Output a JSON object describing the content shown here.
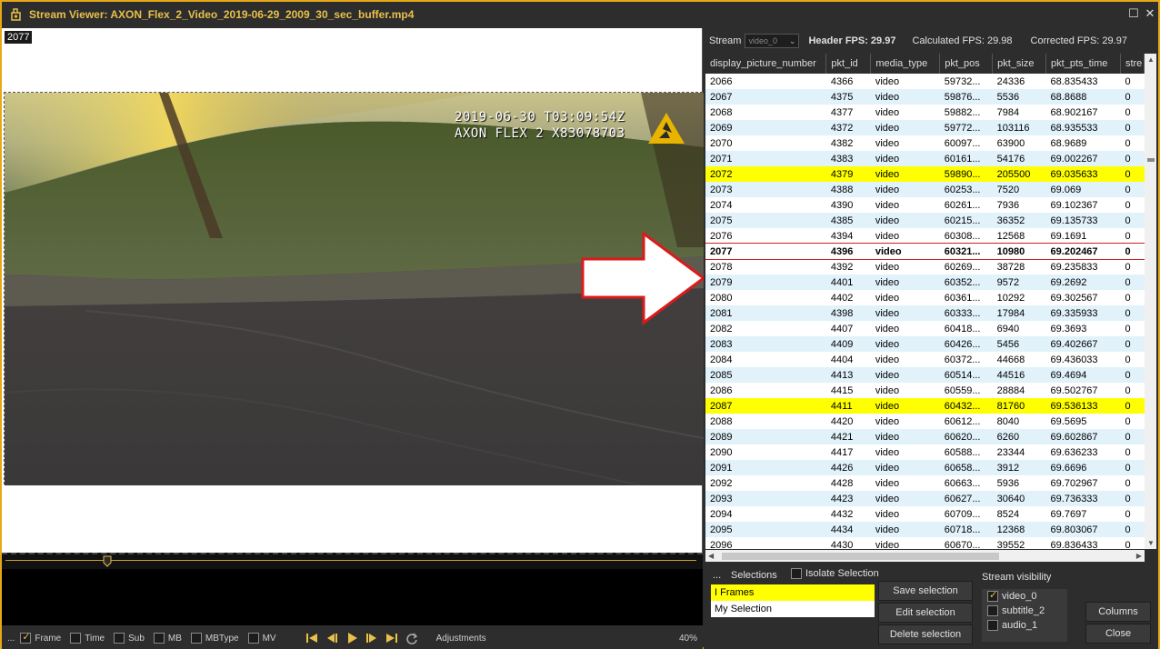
{
  "window": {
    "title": "Stream Viewer: AXON_Flex_2_Video_2019-06-29_2009_30_sec_buffer.mp4"
  },
  "video": {
    "frame_label": "2077",
    "osd_line1": "2019-06-30 T03:09:54Z",
    "osd_line2": "AXON FLEX 2 X83078703"
  },
  "toolbar": {
    "more": "...",
    "frame": "Frame",
    "time": "Time",
    "sub": "Sub",
    "mb": "MB",
    "mbtype": "MBType",
    "mv": "MV",
    "adjustments": "Adjustments",
    "zoom": "40%"
  },
  "stream_header": {
    "stream_label": "Stream",
    "stream_value": "video_0",
    "header_fps": "Header FPS: 29.97",
    "calc_fps": "Calculated FPS: 29.98",
    "corrected_fps": "Corrected FPS: 29.97"
  },
  "table": {
    "columns": [
      "display_picture_number",
      "pkt_id",
      "media_type",
      "pkt_pos",
      "pkt_size",
      "pkt_pts_time",
      "stre"
    ],
    "rows": [
      [
        "2066",
        "4366",
        "video",
        "59732...",
        "24336",
        "68.835433",
        "0"
      ],
      [
        "2067",
        "4375",
        "video",
        "59876...",
        "5536",
        "68.8688",
        "0"
      ],
      [
        "2068",
        "4377",
        "video",
        "59882...",
        "7984",
        "68.902167",
        "0"
      ],
      [
        "2069",
        "4372",
        "video",
        "59772...",
        "103116",
        "68.935533",
        "0"
      ],
      [
        "2070",
        "4382",
        "video",
        "60097...",
        "63900",
        "68.9689",
        "0"
      ],
      [
        "2071",
        "4383",
        "video",
        "60161...",
        "54176",
        "69.002267",
        "0"
      ],
      [
        "2072",
        "4379",
        "video",
        "59890...",
        "205500",
        "69.035633",
        "0"
      ],
      [
        "2073",
        "4388",
        "video",
        "60253...",
        "7520",
        "69.069",
        "0"
      ],
      [
        "2074",
        "4390",
        "video",
        "60261...",
        "7936",
        "69.102367",
        "0"
      ],
      [
        "2075",
        "4385",
        "video",
        "60215...",
        "36352",
        "69.135733",
        "0"
      ],
      [
        "2076",
        "4394",
        "video",
        "60308...",
        "12568",
        "69.1691",
        "0"
      ],
      [
        "2077",
        "4396",
        "video",
        "60321...",
        "10980",
        "69.202467",
        "0"
      ],
      [
        "2078",
        "4392",
        "video",
        "60269...",
        "38728",
        "69.235833",
        "0"
      ],
      [
        "2079",
        "4401",
        "video",
        "60352...",
        "9572",
        "69.2692",
        "0"
      ],
      [
        "2080",
        "4402",
        "video",
        "60361...",
        "10292",
        "69.302567",
        "0"
      ],
      [
        "2081",
        "4398",
        "video",
        "60333...",
        "17984",
        "69.335933",
        "0"
      ],
      [
        "2082",
        "4407",
        "video",
        "60418...",
        "6940",
        "69.3693",
        "0"
      ],
      [
        "2083",
        "4409",
        "video",
        "60426...",
        "5456",
        "69.402667",
        "0"
      ],
      [
        "2084",
        "4404",
        "video",
        "60372...",
        "44668",
        "69.436033",
        "0"
      ],
      [
        "2085",
        "4413",
        "video",
        "60514...",
        "44516",
        "69.4694",
        "0"
      ],
      [
        "2086",
        "4415",
        "video",
        "60559...",
        "28884",
        "69.502767",
        "0"
      ],
      [
        "2087",
        "4411",
        "video",
        "60432...",
        "81760",
        "69.536133",
        "0"
      ],
      [
        "2088",
        "4420",
        "video",
        "60612...",
        "8040",
        "69.5695",
        "0"
      ],
      [
        "2089",
        "4421",
        "video",
        "60620...",
        "6260",
        "69.602867",
        "0"
      ],
      [
        "2090",
        "4417",
        "video",
        "60588...",
        "23344",
        "69.636233",
        "0"
      ],
      [
        "2091",
        "4426",
        "video",
        "60658...",
        "3912",
        "69.6696",
        "0"
      ],
      [
        "2092",
        "4428",
        "video",
        "60663...",
        "5936",
        "69.702967",
        "0"
      ],
      [
        "2093",
        "4423",
        "video",
        "60627...",
        "30640",
        "69.736333",
        "0"
      ],
      [
        "2094",
        "4432",
        "video",
        "60709...",
        "8524",
        "69.7697",
        "0"
      ],
      [
        "2095",
        "4434",
        "video",
        "60718...",
        "12368",
        "69.803067",
        "0"
      ],
      [
        "2096",
        "4430",
        "video",
        "60670...",
        "39552",
        "69.836433",
        "0"
      ]
    ],
    "highlighted_rows": [
      "2072",
      "2087"
    ],
    "selected_row": "2077"
  },
  "selections": {
    "more": "...",
    "label": "Selections",
    "isolate": "Isolate Selection",
    "items": [
      "I Frames",
      "My Selection"
    ],
    "save": "Save selection",
    "edit": "Edit selection",
    "delete": "Delete selection"
  },
  "visibility": {
    "label": "Stream visibility",
    "items": [
      {
        "name": "video_0",
        "checked": true
      },
      {
        "name": "subtitle_2",
        "checked": false
      },
      {
        "name": "audio_1",
        "checked": false
      }
    ]
  },
  "actions": {
    "columns": "Columns",
    "close": "Close"
  },
  "colors": {
    "accent": "#e8c04a",
    "highlight": "#ffff00",
    "alt_row": "#e1f2fb",
    "arrow_outline": "#dd1a1a"
  }
}
